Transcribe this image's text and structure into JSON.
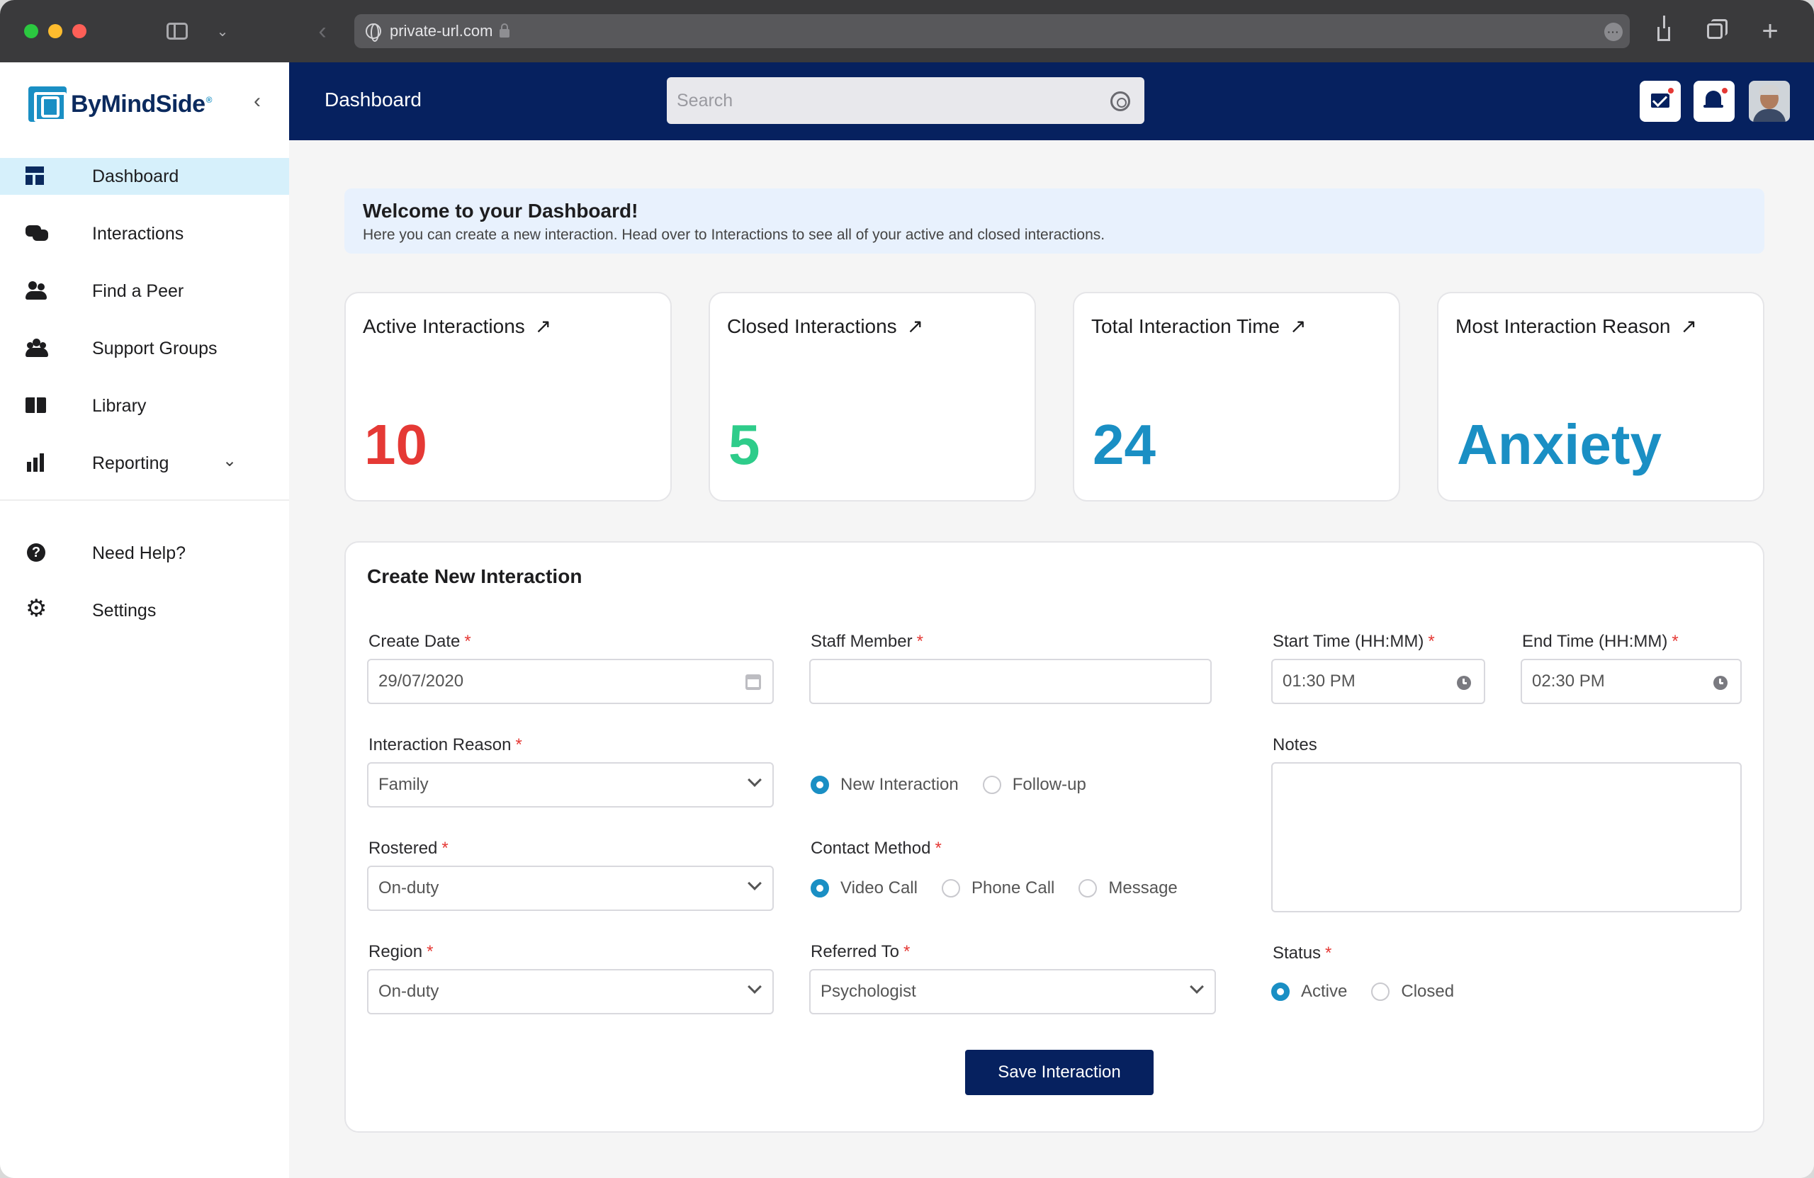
{
  "browser": {
    "url": "private-url.com"
  },
  "sidebar": {
    "brand": {
      "by": "By",
      "mind": "MindSide",
      "reg": "®"
    },
    "items": [
      {
        "label": "Dashboard"
      },
      {
        "label": "Interactions"
      },
      {
        "label": "Find a Peer"
      },
      {
        "label": "Support Groups"
      },
      {
        "label": "Library"
      },
      {
        "label": "Reporting"
      },
      {
        "label": "Need Help?"
      },
      {
        "label": "Settings"
      }
    ]
  },
  "header": {
    "title": "Dashboard",
    "search_placeholder": "Search"
  },
  "welcome": {
    "title": "Welcome to your Dashboard!",
    "subtitle": "Here you can create a new interaction. Head over to Interactions to see all of your active and closed interactions."
  },
  "stats": [
    {
      "title": "Active Interactions",
      "value": "10",
      "color": "#e53935"
    },
    {
      "title": "Closed Interactions",
      "value": "5",
      "color": "#2ecc8a"
    },
    {
      "title": "Total Interaction Time",
      "value": "24",
      "color": "#1a8fc4"
    },
    {
      "title": "Most Interaction Reason",
      "value": "Anxiety",
      "color": "#1a8fc4"
    }
  ],
  "form": {
    "title": "Create New Interaction",
    "create_date": {
      "label": "Create Date",
      "value": "29/07/2020"
    },
    "staff_member": {
      "label": "Staff Member",
      "value": ""
    },
    "start_time": {
      "label": "Start Time (HH:MM)",
      "value": "01:30 PM"
    },
    "end_time": {
      "label": "End Time (HH:MM)",
      "value": "02:30 PM"
    },
    "interaction_reason": {
      "label": "Interaction Reason",
      "value": "Family"
    },
    "interaction_type": {
      "options": [
        "New Interaction",
        "Follow-up"
      ],
      "selected": "New Interaction"
    },
    "notes": {
      "label": "Notes",
      "value": ""
    },
    "rostered": {
      "label": "Rostered",
      "value": "On-duty"
    },
    "contact_method": {
      "label": "Contact Method",
      "options": [
        "Video Call",
        "Phone Call",
        "Message"
      ],
      "selected": "Video Call"
    },
    "region": {
      "label": "Region",
      "value": "On-duty"
    },
    "referred_to": {
      "label": "Referred To",
      "value": "Psychologist"
    },
    "status": {
      "label": "Status",
      "options": [
        "Active",
        "Closed"
      ],
      "selected": "Active"
    },
    "required_mark": "*",
    "save_label": "Save Interaction"
  },
  "colors": {
    "navy": "#06215f",
    "accent": "#1a8fc4",
    "active_nav_bg": "#d6f0fb",
    "required": "#e53935"
  }
}
